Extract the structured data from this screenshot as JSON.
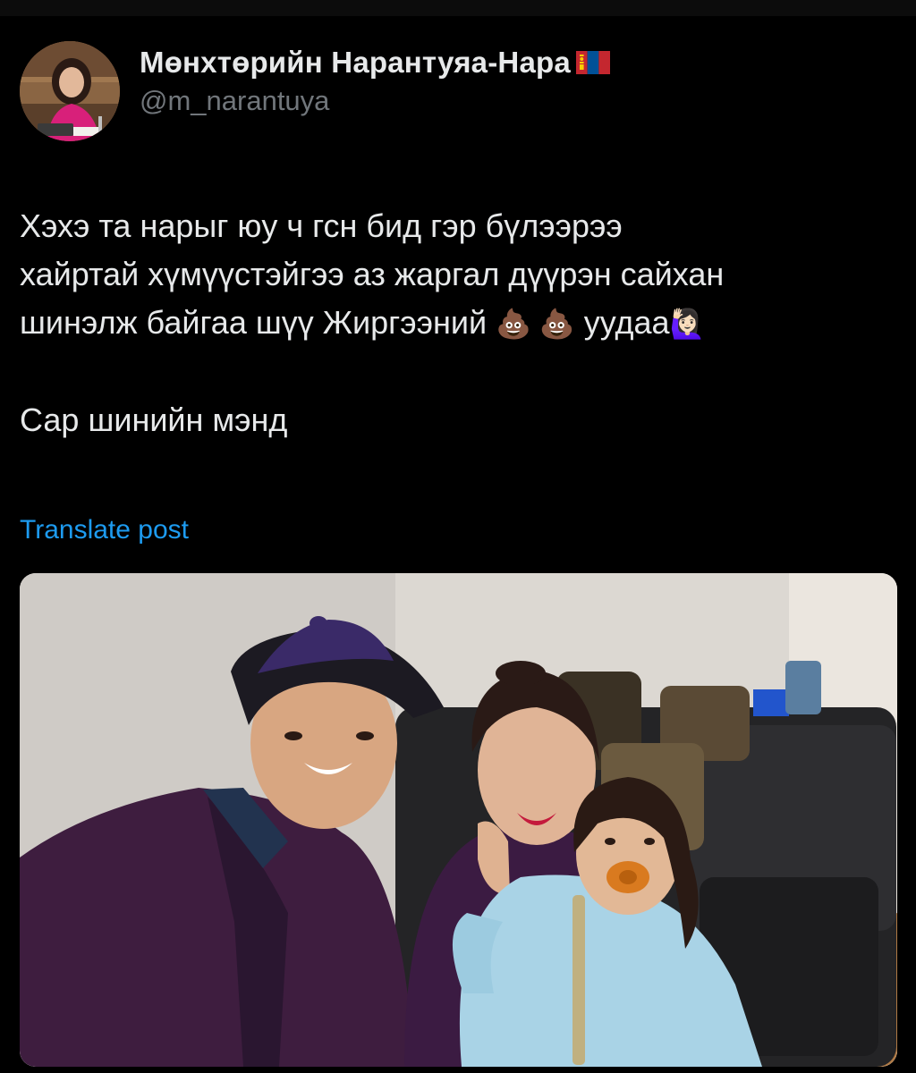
{
  "post": {
    "author": {
      "display_name": "Мөнхтөрийн Нарантуяа-Нара",
      "flag_icon": "mongolia-flag-icon",
      "handle": "@m_narantuya"
    },
    "text": {
      "line1": "Хэхэ та нарыг юу ч гсн бид гэр бүлээрээ",
      "line2": "хайртай хүмүүстэйгээ аз жаргал дүүрэн сайхан",
      "line3_text": "шинэлж байгаа шүү Жиргээний",
      "line3_emoji": "💩 💩",
      "line3_end": "уудаа",
      "line3_end_emoji": "🙋🏻‍♀️",
      "line4": "Сар шинийн мэнд"
    },
    "translate_label": "Translate post"
  },
  "colors": {
    "background": "#000000",
    "text": "#e7e9ea",
    "handle": "#71767b",
    "link": "#1d9bf0"
  }
}
